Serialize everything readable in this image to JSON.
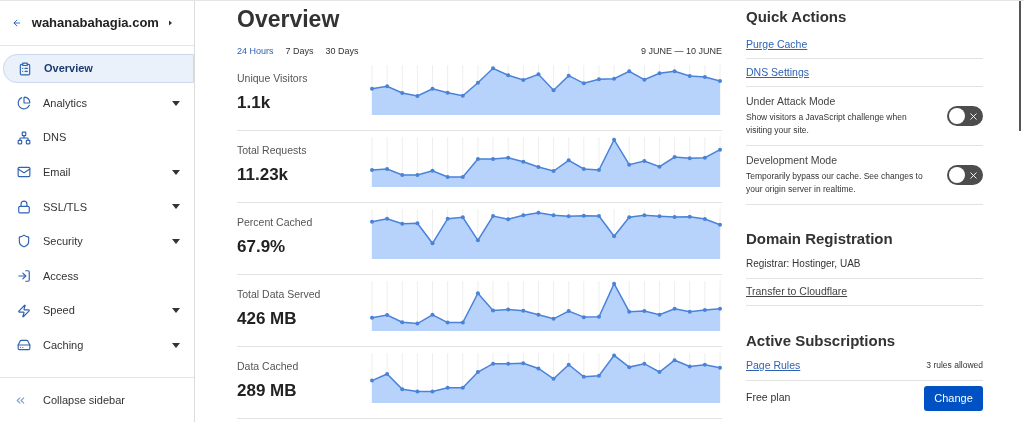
{
  "sidebar": {
    "domain": "wahanabahagia.com",
    "items": [
      {
        "label": "Overview",
        "selected": true,
        "expandable": false
      },
      {
        "label": "Analytics",
        "selected": false,
        "expandable": true
      },
      {
        "label": "DNS",
        "selected": false,
        "expandable": false
      },
      {
        "label": "Email",
        "selected": false,
        "expandable": true
      },
      {
        "label": "SSL/TLS",
        "selected": false,
        "expandable": true
      },
      {
        "label": "Security",
        "selected": false,
        "expandable": true
      },
      {
        "label": "Access",
        "selected": false,
        "expandable": false
      },
      {
        "label": "Speed",
        "selected": false,
        "expandable": true
      },
      {
        "label": "Caching",
        "selected": false,
        "expandable": true
      }
    ],
    "collapse": "Collapse sidebar"
  },
  "main": {
    "title": "Overview",
    "ranges": [
      {
        "label": "24 Hours",
        "selected": true
      },
      {
        "label": "7 Days",
        "selected": false
      },
      {
        "label": "30 Days",
        "selected": false
      }
    ],
    "date_range": "9 JUNE — 10 JUNE",
    "metrics": [
      {
        "label": "Unique Visitors",
        "value": "1.1k"
      },
      {
        "label": "Total Requests",
        "value": "11.23k"
      },
      {
        "label": "Percent Cached",
        "value": "67.9%"
      },
      {
        "label": "Total Data Served",
        "value": "426 MB"
      },
      {
        "label": "Data Cached",
        "value": "289 MB"
      }
    ]
  },
  "quick_actions": {
    "title": "Quick Actions",
    "links": [
      "Purge Cache",
      "DNS Settings"
    ],
    "toggles": [
      {
        "title": "Under Attack Mode",
        "description": "Show visitors a JavaScript challenge when visiting your site.",
        "on": false
      },
      {
        "title": "Development Mode",
        "description": "Temporarily bypass our cache. See changes to your origin server in realtime.",
        "on": false
      }
    ]
  },
  "domain_registration": {
    "title": "Domain Registration",
    "registrar": "Registrar: Hostinger, UAB",
    "link": "Transfer to Cloudflare"
  },
  "subscriptions": {
    "title": "Active Subscriptions",
    "link": "Page Rules",
    "note": "3 rules allowed",
    "plan": "Free plan",
    "button": "Change"
  }
}
